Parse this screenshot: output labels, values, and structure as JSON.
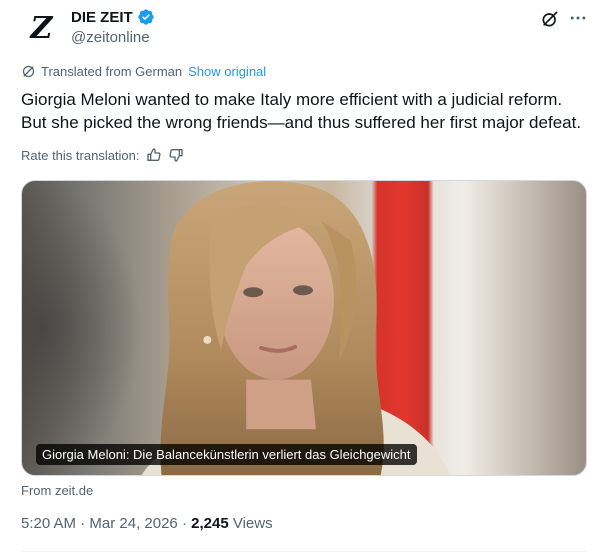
{
  "author": {
    "display_name": "DIE ZEIT",
    "handle": "@zeitonline",
    "avatar_letter": "Z",
    "verified": true,
    "verified_color": "#1d9bf0"
  },
  "header_icons": [
    "grok-icon",
    "more-icon"
  ],
  "translation": {
    "label": "Translated from German",
    "show_original": "Show original",
    "rate_label": "Rate this translation:"
  },
  "tweet": {
    "text": "Giorgia Meloni wanted to make Italy more efficient with a judicial reform. But she picked the wrong friends—and thus suffered her first major defeat."
  },
  "card": {
    "caption": "Giorgia Meloni: Die Balancekünstlerin verliert das Gleichgewicht",
    "source": "From zeit.de"
  },
  "meta": {
    "time": "5:20 AM",
    "separator": "·",
    "date": "Mar 24, 2026",
    "views_count": "2,245",
    "views_label": "Views"
  },
  "colors": {
    "text_primary": "#0f1419",
    "text_secondary": "#536471",
    "link": "#1d9bf0"
  }
}
